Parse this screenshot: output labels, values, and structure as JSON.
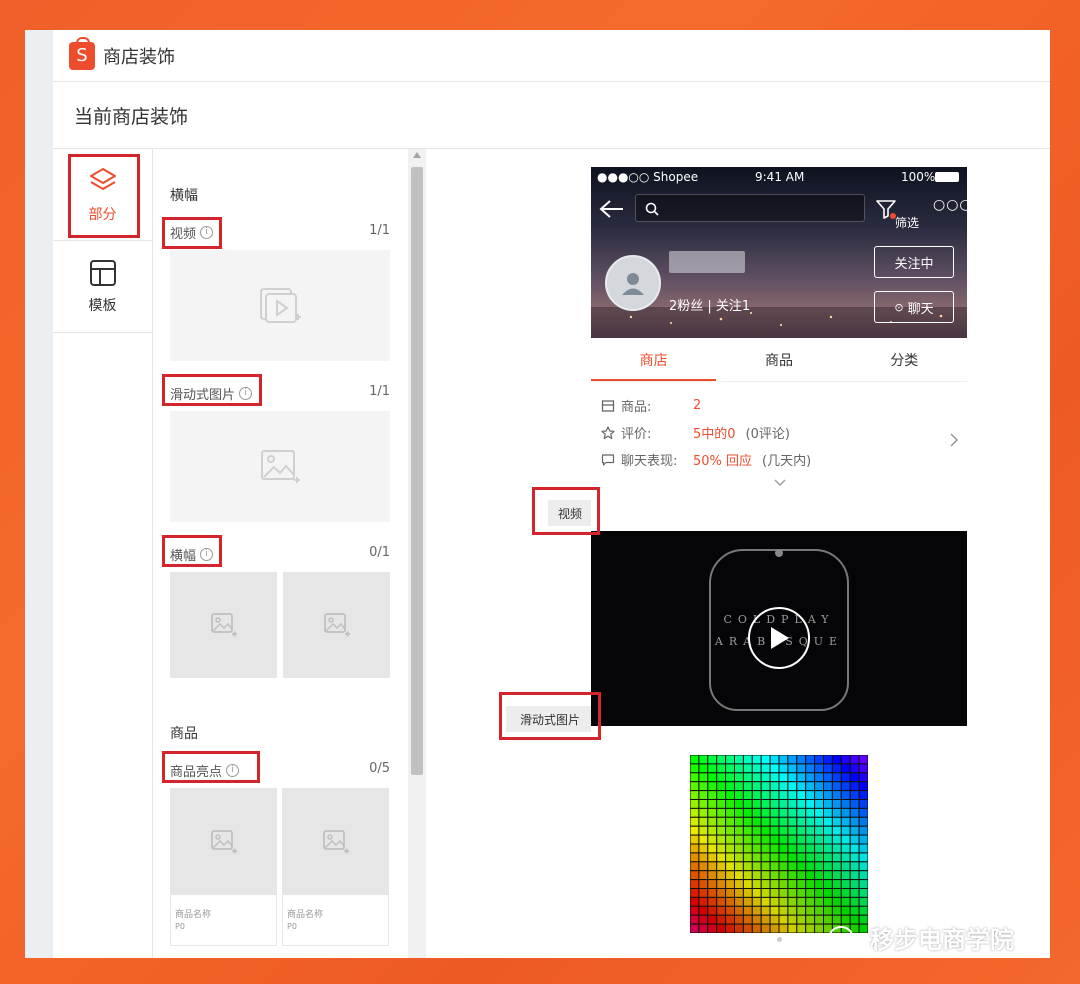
{
  "app": {
    "title": "商店装饰",
    "page_title": "当前商店装饰"
  },
  "nav": [
    {
      "label": "部分",
      "active": true
    },
    {
      "label": "模板",
      "active": false
    }
  ],
  "panel": {
    "banner_section": "横幅",
    "rows": [
      {
        "label": "视频",
        "count": "1/1"
      },
      {
        "label": "滑动式图片",
        "count": "1/1"
      },
      {
        "label": "横幅",
        "count": "0/1"
      }
    ],
    "product_section": "商品",
    "product_row": {
      "label": "商品亮点",
      "count": "0/5"
    },
    "product_cards": [
      {
        "name": "商品名称",
        "price": "P0"
      },
      {
        "name": "商品名称",
        "price": "P0"
      }
    ]
  },
  "preview_tags": {
    "video": "视频",
    "slider": "滑动式图片"
  },
  "phone": {
    "status": {
      "carrier": "●●●○○ Shopee",
      "time": "9:41 AM",
      "battery": "100%"
    },
    "filter_label": "筛选",
    "follow_button": "关注中",
    "chat_button": "聊天",
    "followers": "2粉丝 | 关注1",
    "tabs": [
      "商店",
      "商品",
      "分类"
    ],
    "stats": [
      {
        "label": "商品:",
        "value": "2",
        "note": ""
      },
      {
        "label": "评价:",
        "value": "5中的0",
        "note": "(0评论)"
      },
      {
        "label": "聊天表现:",
        "value": "50% 回应",
        "note": "(几天内)"
      }
    ],
    "video_text": [
      "COLDPLAY",
      "ARABESQUE"
    ]
  },
  "watermark": "移步电商学院",
  "colors": {
    "accent": "#ee4d2d",
    "highlight": "#d4252b",
    "background": "#f0602a"
  }
}
